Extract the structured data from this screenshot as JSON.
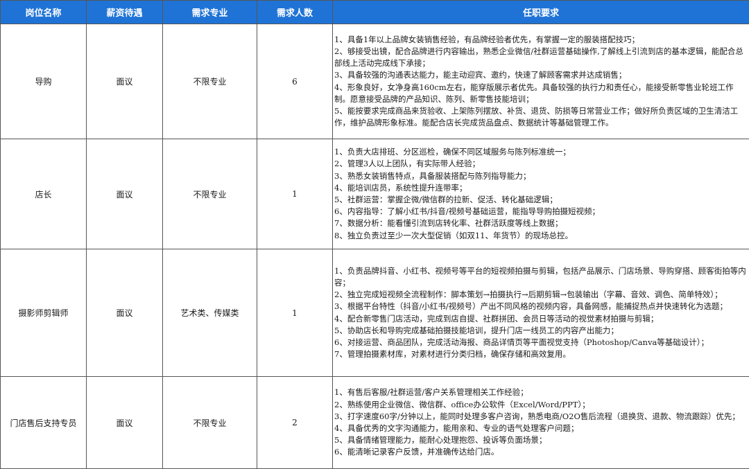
{
  "headers": {
    "position": "岗位名称",
    "salary": "薪资待遇",
    "major": "需求专业",
    "count": "需求人数",
    "requirements": "任职要求"
  },
  "rows": [
    {
      "position": "导购",
      "salary": "面议",
      "major": "不限专业",
      "count": "6",
      "requirements": [
        "1、具备1年以上品牌女装销售经验，有品牌经验者优先，有掌握一定的服装搭配技巧；",
        "2、够接受出镜，配合品牌进行内容输出，熟悉企业微信/社群运营基础操作,了解线上引流到店的基本逻辑，能配合总部线上活动完成线下承接；",
        "3、具备较强的沟通表达能力，能主动迎宾、邀约，快速了解顾客需求并达成销售；",
        "4、形象良好，女净身高160cm左右，能穿版展示者优先。具备较强的执行力和责任心，能接受新零售业轮班工作制。愿意接受品牌的产品知识、陈列、新零售技能培训；",
        "5、能按要求完成商品来货验收、上架陈列摆放、补货、退货、防损等日常营业工作；做好所负责区域的卫生清洁工作，维护品牌形象标准。能配合店长完成货品盘点、数据统计等基础管理工作。"
      ]
    },
    {
      "position": "店长",
      "salary": "面议",
      "major": "不限专业",
      "count": "1",
      "requirements": [
        "1、负责大店排班、分区巡检，确保不同区域服务与陈列标准统一；",
        "2、管理3人以上团队，有实际带人经验；",
        "3、熟悉女装销售特点，具备服装搭配与陈列指导能力；",
        "4、能培训店员，系统性提升连带率；",
        "5、社群运营：掌握企微/微信群的拉新、促活、转化基础逻辑；",
        "6、内容指导：了解小红书/抖音/视频号基础运营，能指导导购拍摄短视频；",
        "7、数据分析：能看懂引流到店转化率、社群活跃度等线上数据；",
        "8、独立负责过至少一次大型促销（如双11、年货节）的现场总控。"
      ]
    },
    {
      "position": "摄影师剪辑师",
      "salary": "面议",
      "major": "艺术类、传媒类",
      "count": "1",
      "requirements": [
        "1、负责品牌抖音、小红书、视频号等平台的短视频拍摄与剪辑，包括产品展示、门店场景、导购穿搭、顾客街拍等内容；",
        "2、独立完成短视频全流程制作：脚本策划→拍摄执行→后期剪辑→包装输出（字幕、音效、调色、简单特效）；",
        "3、根据平台特性（抖音/小红书/视频号）产出不同风格的视频内容，具备网感，能捕捉热点并快速转化为选题；",
        "4、配合新零售门店活动，完成到店自提、社群拼团、会员日等活动的视觉素材拍摄与剪辑；",
        "5、协助店长和导购完成基础拍摄技能培训，提升门店一线员工的内容产出能力；",
        "6、对接运营、商品团队，完成活动海报、商品详情页等平面视觉支持（Photoshop/Canva等基础设计）；",
        "7、管理拍摄素材库，对素材进行分类归档，确保存储和高效复用。"
      ]
    },
    {
      "position": "门店售后支持专员",
      "salary": "面议",
      "major": "不限专业",
      "count": "2",
      "requirements": [
        "1、有售后客服/社群运营/客户关系管理相关工作经验；",
        "2、熟练使用企业微信、微信群、office办公软件（Excel/Word/PPT）；",
        "3、打字速度60字/分钟以上，能同时处理多客户咨询，熟悉电商/O2O售后流程（退换货、退款、物流跟踪）优先；",
        "4、具备优秀的文字沟通能力，能用亲和、专业的语气处理客户问题；",
        "5、具备情绪管理能力，能耐心处理抱怨、投诉等负面场景；",
        "6、能清晰记录客户反馈，并准确传达给门店。"
      ]
    }
  ]
}
